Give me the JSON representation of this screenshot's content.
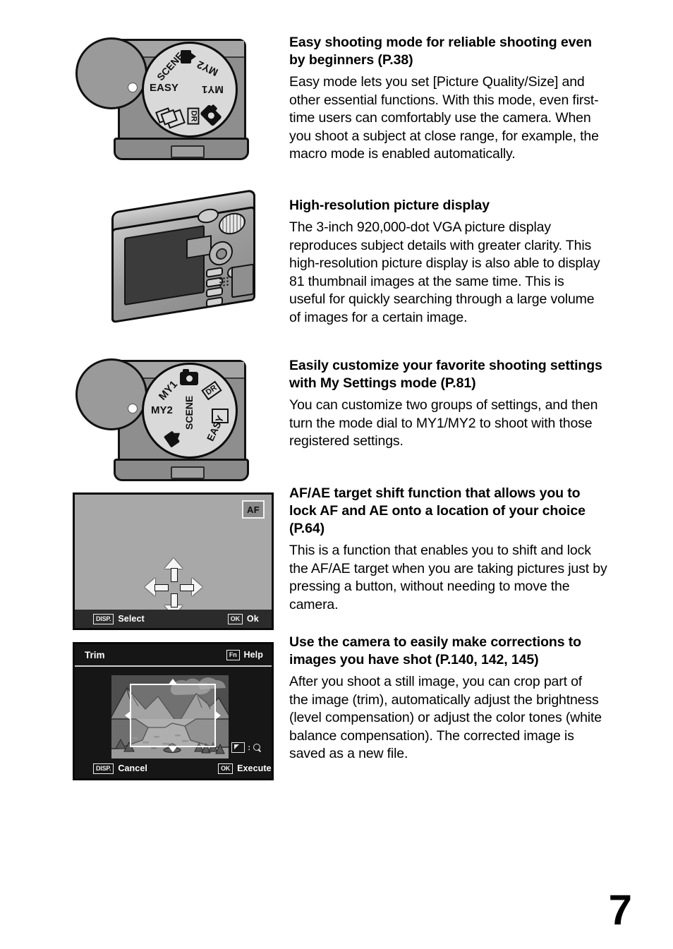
{
  "page": {
    "number": "7"
  },
  "features": [
    {
      "heading": "Easy shooting mode for reliable shooting even by beginners (P.38)",
      "body": "Easy mode lets you set [Picture Quality/Size] and other essential functions. With this mode, even first-time users can comfortably use the camera. When you shoot a subject at close range, for example, the macro mode is enabled automatically."
    },
    {
      "heading": "High-resolution picture display",
      "body": "The 3-inch 920,000-dot VGA picture display reproduces subject details with greater clarity. This high-resolution picture display is also able to display 81 thumbnail images at the same time. This is useful for quickly searching through a large volume of images for a certain image."
    },
    {
      "heading": "Easily customize your favorite shooting settings with My Settings mode (P.81)",
      "body": "You can customize two groups of settings, and then turn the mode dial to MY1/MY2 to shoot with those registered settings."
    },
    {
      "heading": "AF/AE target shift function that allows you to lock AF and AE onto a location of your choice (P.64)",
      "body": "This is a function that enables you to shift and lock the AF/AE target when you are taking pictures just by pressing a button, without needing to move the camera."
    },
    {
      "heading": "Use the camera to easily make corrections to images you have shot (P.140, 142, 145)",
      "body": "After you shoot a still image, you can crop part of the image (trim), automatically adjust the brightness (level compensation) or adjust the color tones (white balance compensation). The corrected image is saved as a new file."
    }
  ],
  "figures": {
    "mode_dial_easy": {
      "caption_icon": "mode-dial-icon",
      "labels": {
        "easy": "EASY",
        "scene": "SCENE",
        "my1": "MY1",
        "my2": "MY2",
        "dr": "DR"
      }
    },
    "camera_back": {
      "caption_icon": "camera-back-icon"
    },
    "mode_dial_my": {
      "caption_icon": "mode-dial-icon",
      "labels": {
        "easy": "EASY",
        "scene": "SCENE",
        "my1": "MY1",
        "my2": "MY2",
        "dr": "DR"
      }
    }
  },
  "af_screen": {
    "badge": "AF",
    "bar": {
      "left_key": "DISP.",
      "left_label": "Select",
      "right_key": "OK",
      "right_label": "Ok"
    }
  },
  "trim_screen": {
    "title": "Trim",
    "help_key": "Fn",
    "help_label": "Help",
    "zoom_hint_separator": ":",
    "bar": {
      "left_key": "DISP.",
      "left_label": "Cancel",
      "right_key": "OK",
      "right_label": "Execute"
    }
  },
  "colors": {
    "page_background": "#ffffff",
    "text": "#000000",
    "lcd_gray": "#a8a8a8",
    "lcd_dark": "#161616",
    "lcd_bar": "#2b2b2b",
    "lcd_white": "#ffffff"
  }
}
